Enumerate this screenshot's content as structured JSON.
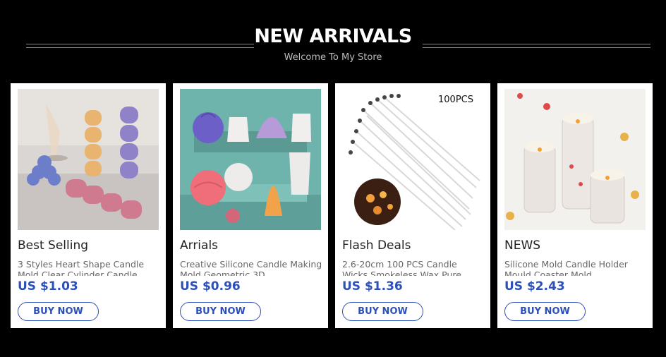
{
  "header": {
    "title": "NEW ARRIVALS",
    "subtitle": "Welcome To My Store"
  },
  "products": [
    {
      "category": "Best Selling",
      "description": "3 Styles Heart Shape Candle Mold Clear Cylinder Candle",
      "price": "US $1.03",
      "button": "BUY NOW"
    },
    {
      "category": "Arrials",
      "description": "Creative Silicone Candle Making Mold Geometric 3D",
      "price": "US $0.96",
      "button": "BUY NOW"
    },
    {
      "category": "Flash Deals",
      "description": "2.6-20cm 100 PCS Candle Wicks Smokeless Wax Pure",
      "price": "US $1.36",
      "button": "BUY NOW",
      "image_badge": "100PCS"
    },
    {
      "category": "NEWS",
      "description": "Silicone Mold Candle Holder Mould Coaster Mold",
      "price": "US $2.43",
      "button": "BUY NOW"
    }
  ]
}
